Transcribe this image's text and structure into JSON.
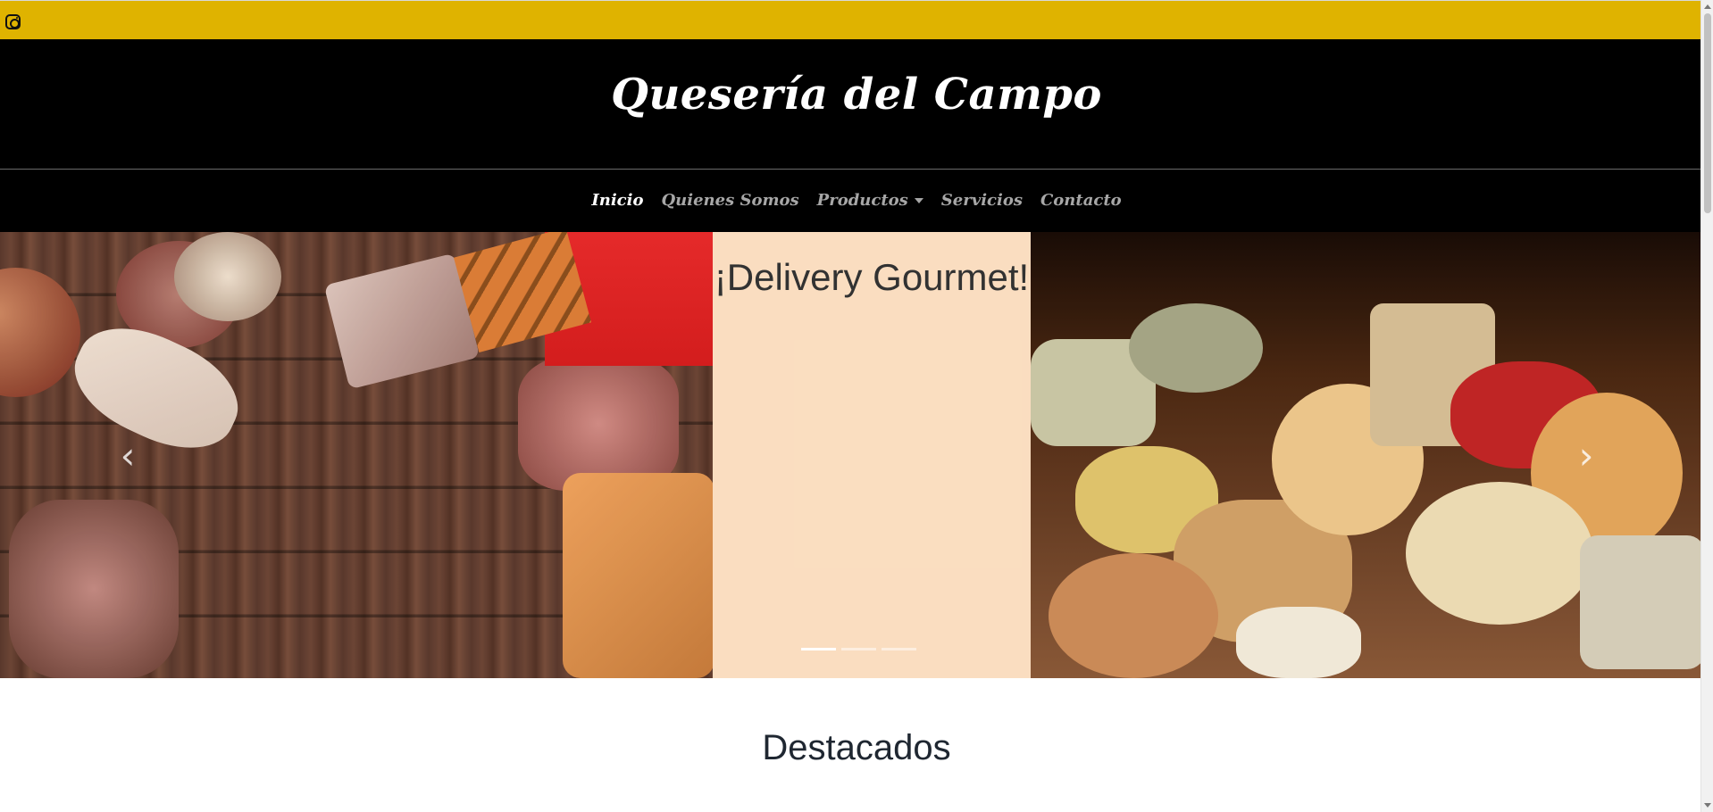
{
  "top_bar": {
    "instagram_icon": "instagram-icon"
  },
  "header": {
    "brand": "Quesería del Campo"
  },
  "nav": {
    "items": [
      {
        "label": "Inicio",
        "active": true
      },
      {
        "label": "Quienes Somos",
        "active": false
      },
      {
        "label": "Productos",
        "active": false,
        "has_dropdown": true
      },
      {
        "label": "Servicios",
        "active": false
      },
      {
        "label": "Contacto",
        "active": false
      }
    ]
  },
  "carousel": {
    "caption": "¡Delivery Gourmet!",
    "active_indicator": 1,
    "indicator_count": 3,
    "prev_icon": "chevron-left-icon",
    "next_icon": "chevron-right-icon"
  },
  "section": {
    "title": "Destacados"
  },
  "colors": {
    "top_bar": "#dfb300",
    "header_bg": "#000000",
    "caption_panel": "#ffe2c4",
    "nav_active": "#ffffff",
    "nav_inactive": "#a7a7a7"
  }
}
